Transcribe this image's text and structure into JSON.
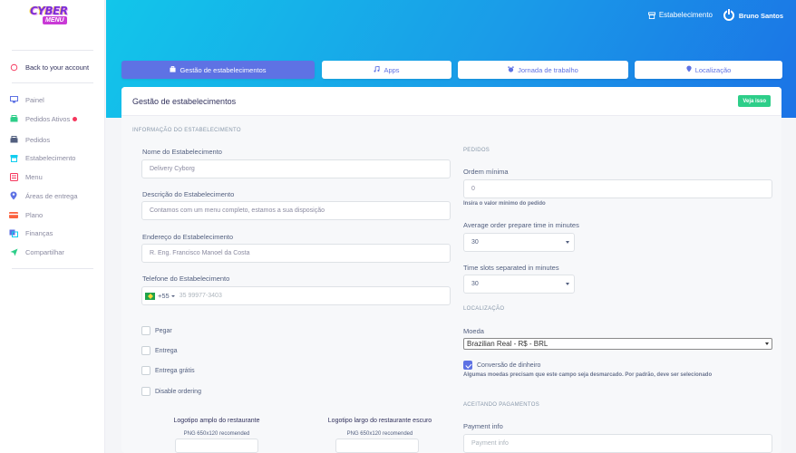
{
  "logo": {
    "line1": "CYBER",
    "line2": "MENU"
  },
  "sidebar": {
    "back": "Back to your account",
    "items": [
      {
        "label": "Painel",
        "icon": "monitor-icon",
        "color": "#5e72e4"
      },
      {
        "label": "Pedidos Ativos",
        "icon": "basket-icon",
        "color": "#2dce89",
        "badge": true
      },
      {
        "label": "Pedidos",
        "icon": "basket-icon",
        "color": "#525f7f"
      },
      {
        "label": "Estabelecimento",
        "icon": "store-icon",
        "color": "#11cdef"
      },
      {
        "label": "Menu",
        "icon": "menu-book-icon",
        "color": "#f5365c"
      },
      {
        "label": "Áreas de entrega",
        "icon": "map-pin-icon",
        "color": "#5e72e4"
      },
      {
        "label": "Plano",
        "icon": "credit-card-icon",
        "color": "#fb6340"
      },
      {
        "label": "Finanças",
        "icon": "finance-icon",
        "color": "#5e72e4"
      },
      {
        "label": "Compartilhar",
        "icon": "send-icon",
        "color": "#2dce89"
      }
    ]
  },
  "header": {
    "establishment": "Estabelecimento",
    "user": "Bruno Santos"
  },
  "tabs": [
    {
      "label": "Gestão de estabelecimentos",
      "icon": "briefcase-icon"
    },
    {
      "label": "Apps",
      "icon": "music-note-icon"
    },
    {
      "label": "Jornada de trabalho",
      "icon": "alarm-icon"
    },
    {
      "label": "Localização",
      "icon": "map-pin-icon"
    }
  ],
  "card": {
    "title": "Gestão de estabelecimentos",
    "view_button": "Veja isso",
    "info_section": "INFORMAÇÃO DO ESTABELECIMENTO",
    "name_label": "Nome do Estabelecimento",
    "name_value": "Delivery Cyborg",
    "desc_label": "Descrição do Estabelecimento",
    "desc_value": "Contamos com um menu completo, estamos a sua disposição",
    "address_label": "Endereço do Estabelecimento",
    "address_value": "R. Eng. Francisco Manoel da Costa",
    "phone_label": "Telefone do Estabelecimento",
    "phone_code": "+55",
    "phone_placeholder": "35 99977-3403",
    "checkboxes": [
      {
        "label": "Pegar",
        "checked": false
      },
      {
        "label": "Entrega",
        "checked": false
      },
      {
        "label": "Entrega grátis",
        "checked": false
      },
      {
        "label": "Disable ordering",
        "checked": false
      }
    ],
    "logo_wide_title": "Logotipo amplo do restaurante",
    "logo_wide_sub": "PNG 650x120 recomended",
    "logo_dark_title": "Logotipo largo do restaurante escuro",
    "logo_dark_sub": "PNG 650x120 recomended",
    "orders_section": "PEDIDOS",
    "min_order_label": "Ordem mínima",
    "min_order_value": "0",
    "min_order_hint": "Insira o valor mínimo do pedido",
    "prep_time_label": "Average order prepare time in minutes",
    "prep_time_value": "30",
    "time_slots_label": "Time slots separated in minutes",
    "time_slots_value": "30",
    "location_section": "LOCALIZAÇÃO",
    "currency_label": "Moeda",
    "currency_value": "Brazilian Real - R$ - BRL",
    "conversion_label": "Conversão de dinheiro",
    "conversion_hint": "Algumas moedas precisam que este campo seja desmarcado. Por padrão, deve ser selecionado",
    "payments_section": "ACEITANDO PAGAMENTOS",
    "payment_info_label": "Payment info",
    "payment_info_placeholder": "Payment info"
  }
}
